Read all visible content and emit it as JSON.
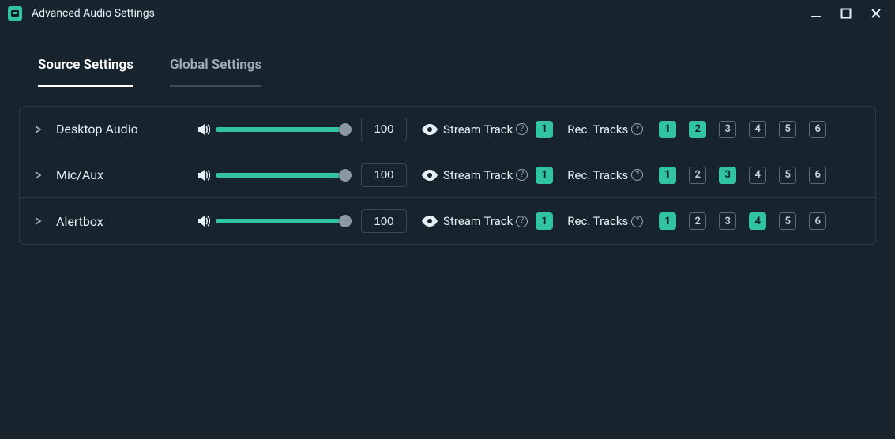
{
  "window": {
    "title": "Advanced Audio Settings"
  },
  "tabs": {
    "source": "Source Settings",
    "global": "Global Settings",
    "active": "source"
  },
  "labels": {
    "stream_track": "Stream Track",
    "rec_tracks": "Rec. Tracks",
    "help": "?"
  },
  "sources": [
    {
      "name": "Desktop Audio",
      "volume": "100",
      "stream_track": "1",
      "rec_tracks": [
        {
          "n": "1",
          "on": true
        },
        {
          "n": "2",
          "on": true
        },
        {
          "n": "3",
          "on": false
        },
        {
          "n": "4",
          "on": false
        },
        {
          "n": "5",
          "on": false
        },
        {
          "n": "6",
          "on": false
        }
      ]
    },
    {
      "name": "Mic/Aux",
      "volume": "100",
      "stream_track": "1",
      "rec_tracks": [
        {
          "n": "1",
          "on": true
        },
        {
          "n": "2",
          "on": false
        },
        {
          "n": "3",
          "on": true
        },
        {
          "n": "4",
          "on": false
        },
        {
          "n": "5",
          "on": false
        },
        {
          "n": "6",
          "on": false
        }
      ]
    },
    {
      "name": "Alertbox",
      "volume": "100",
      "stream_track": "1",
      "rec_tracks": [
        {
          "n": "1",
          "on": true
        },
        {
          "n": "2",
          "on": false
        },
        {
          "n": "3",
          "on": false
        },
        {
          "n": "4",
          "on": true
        },
        {
          "n": "5",
          "on": false
        },
        {
          "n": "6",
          "on": false
        }
      ]
    }
  ]
}
